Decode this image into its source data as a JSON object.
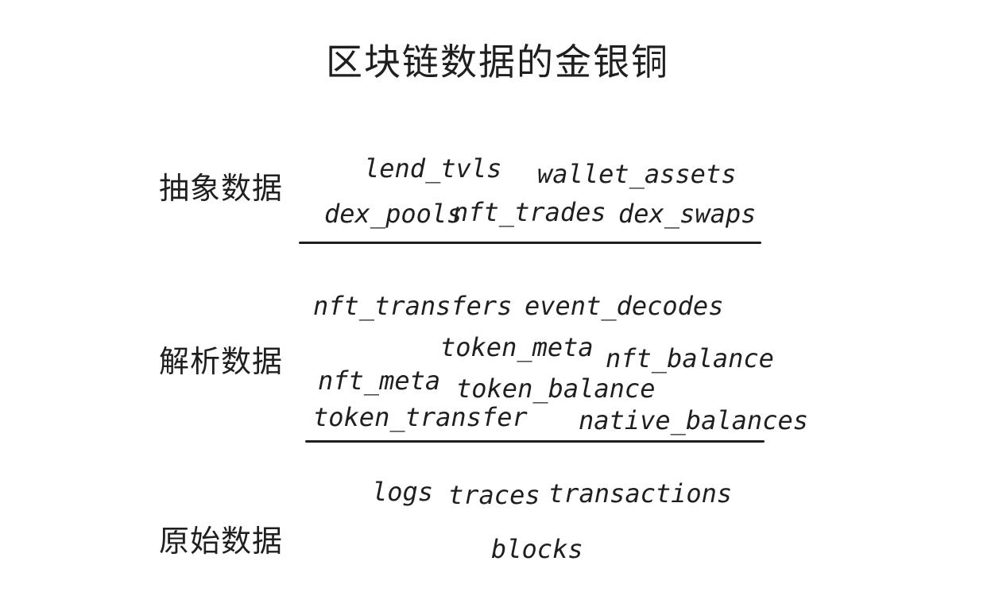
{
  "title": "区块链数据的金银铜",
  "layers": [
    {
      "label": "抽象数据",
      "tables": [
        "lend_tvls",
        "wallet_assets",
        "dex_pools",
        "nft_trades",
        "dex_swaps"
      ]
    },
    {
      "label": "解析数据",
      "tables": [
        "nft_transfers",
        "event_decodes",
        "token_meta",
        "nft_balance",
        "nft_meta",
        "token_balance",
        "token_transfer",
        "native_balances"
      ]
    },
    {
      "label": "原始数据",
      "tables": [
        "logs",
        "traces",
        "transactions",
        "blocks"
      ]
    }
  ]
}
